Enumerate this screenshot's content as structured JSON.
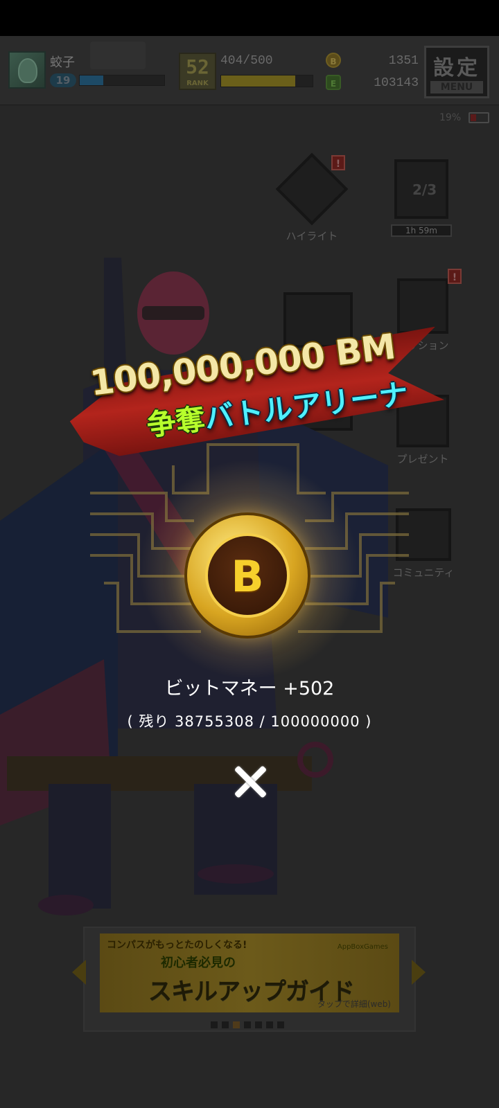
{
  "hud": {
    "player_name": "蛟子",
    "level": "19",
    "exp_fraction": 0.28,
    "rank_number": "52",
    "rank_label": "RANK",
    "stamina": "404/500",
    "stamina_fraction": 0.808,
    "currency_icon_1": "B",
    "currency_1": "1351",
    "currency_icon_2": "E",
    "currency_2": "103143",
    "settings_label": "設定",
    "settings_sub": "MENU",
    "battery": "19%"
  },
  "menu": {
    "highlight": "ハイライト",
    "tower_count": "2/3",
    "tower_timer": "1h 59m",
    "mission": "ミッション",
    "present": "プレゼント",
    "community": "コミュニティ",
    "alert_mark": "!"
  },
  "banner": {
    "title": "100,000,000 BM",
    "subtitle_green": "争奪",
    "subtitle_cyan": "バトルアリーナ"
  },
  "reward": {
    "coin_glyph": "B",
    "line": "ビットマネー +502",
    "remaining": "( 残り 38755308 / 100000000 )"
  },
  "ad": {
    "top_text": "コンパスがもっとたのしくなる!",
    "mid_text": "初心者必見の",
    "main_text": "スキルアップガイド",
    "tap_text": "タップで詳細(web)",
    "brand": "AppBoxGames"
  },
  "carousel": {
    "dot_count": 7,
    "active_index": 2
  },
  "colors": {
    "accent_gold": "#f4e7a7",
    "accent_cyan": "#4ff0ff",
    "accent_green": "#b7ff2c",
    "banner_red": "#b3241c"
  }
}
